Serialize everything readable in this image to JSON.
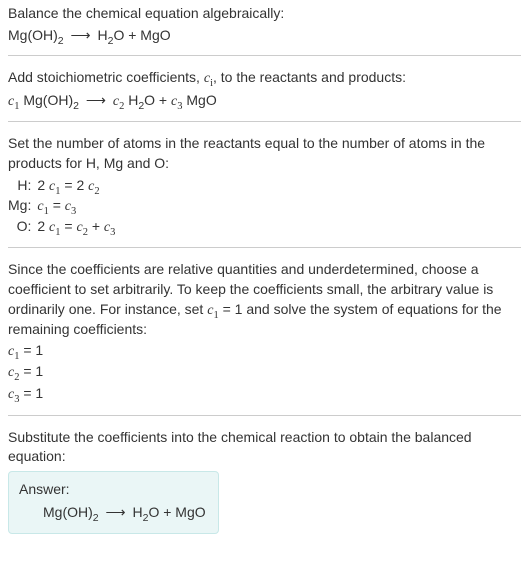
{
  "intro": {
    "line1": "Balance the chemical equation algebraically:",
    "eq_lhs": "Mg(OH)",
    "eq_lhs_sub": "2",
    "arrow": "⟶",
    "eq_rhs_h2o": "H",
    "eq_rhs_h2o_sub": "2",
    "eq_rhs_o": "O + MgO"
  },
  "stoich": {
    "text_pre": "Add stoichiometric coefficients, ",
    "ci": "c",
    "ci_sub": "i",
    "text_post": ", to the reactants and products:",
    "c1": "c",
    "c1_sub": "1",
    "sp1": " Mg(OH)",
    "sp1_sub": "2",
    "arrow": "⟶",
    "c2": "c",
    "c2_sub": "2",
    "sp2": " H",
    "sp2_sub": "2",
    "sp2_o": "O + ",
    "c3": "c",
    "c3_sub": "3",
    "sp3": " MgO"
  },
  "atoms": {
    "intro": "Set the number of atoms in the reactants equal to the number of atoms in the products for H, Mg and O:",
    "rows": [
      {
        "el": "H:",
        "lhs_coef": "2 ",
        "lhs_c": "c",
        "lhs_sub": "1",
        "eq": " = 2 ",
        "rhs_c": "c",
        "rhs_sub": "2",
        "extra": ""
      },
      {
        "el": "Mg:",
        "lhs_coef": "",
        "lhs_c": "c",
        "lhs_sub": "1",
        "eq": " = ",
        "rhs_c": "c",
        "rhs_sub": "3",
        "extra": ""
      },
      {
        "el": "O:",
        "lhs_coef": "2 ",
        "lhs_c": "c",
        "lhs_sub": "1",
        "eq": " = ",
        "rhs_c": "c",
        "rhs_sub": "2",
        "extra_plus": " + ",
        "extra_c": "c",
        "extra_sub": "3"
      }
    ]
  },
  "solve": {
    "text_pre": "Since the coefficients are relative quantities and underdetermined, choose a coefficient to set arbitrarily. To keep the coefficients small, the arbitrary value is ordinarily one. For instance, set ",
    "c1": "c",
    "c1_sub": "1",
    "text_post": " = 1 and solve the system of equations for the remaining coefficients:",
    "lines": [
      {
        "c": "c",
        "sub": "1",
        "val": " = 1"
      },
      {
        "c": "c",
        "sub": "2",
        "val": " = 1"
      },
      {
        "c": "c",
        "sub": "3",
        "val": " = 1"
      }
    ]
  },
  "subst": {
    "text": "Substitute the coefficients into the chemical reaction to obtain the balanced equation:"
  },
  "answer": {
    "label": "Answer:",
    "lhs": "Mg(OH)",
    "lhs_sub": "2",
    "arrow": "⟶",
    "rhs_h": "H",
    "rhs_h_sub": "2",
    "rhs_rest": "O + MgO"
  }
}
